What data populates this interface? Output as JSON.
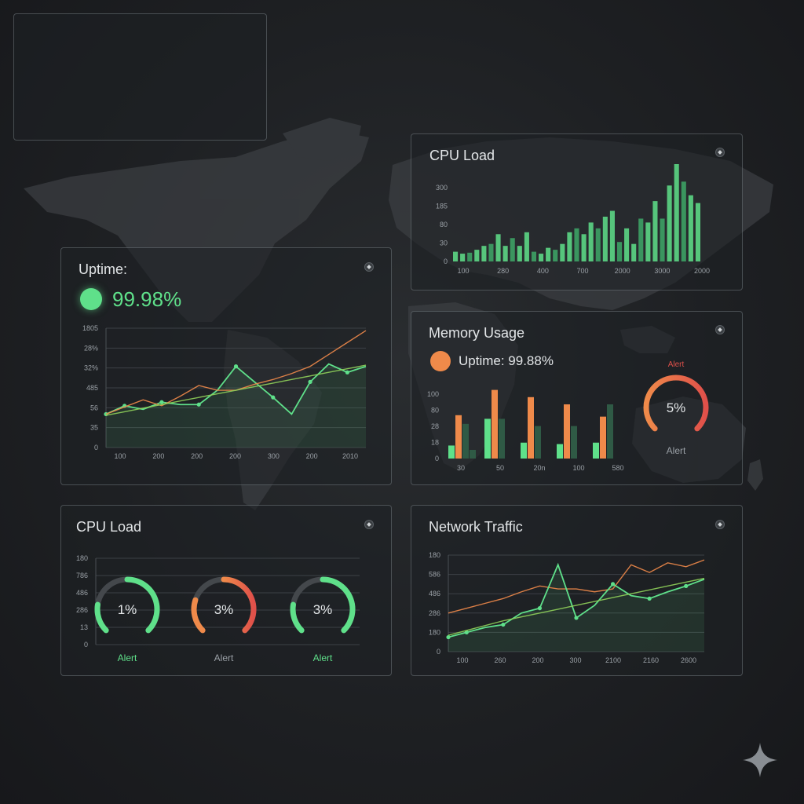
{
  "colors": {
    "green": "#5fe08a",
    "orange": "#ef8a4a",
    "red": "#e0504a",
    "dark_green": "#2f5a45",
    "panel_border": "#8a9096"
  },
  "icons": {
    "panel_menu": "settings-dot-icon",
    "brand": "sparkle-icon",
    "map": "world-map"
  },
  "uptime_panel": {
    "title": "Uptime:",
    "value": "99.98%"
  },
  "cpu_bar_panel": {
    "title": "CPU Load"
  },
  "memory_panel": {
    "title": "Memory Usage",
    "status_text": "Uptime: 99.88%",
    "gauge_value": "5%",
    "gauge_top_label": "Alert",
    "gauge_bottom_label": "Alert"
  },
  "cpu_gauge_panel": {
    "title": "CPU Load",
    "gauges": [
      {
        "value": "1%",
        "label": "Alert"
      },
      {
        "value": "3%",
        "label": "Alert"
      },
      {
        "value": "3%",
        "label": "Alert"
      }
    ]
  },
  "network_panel": {
    "title": "Network Traffic"
  },
  "chart_data": [
    {
      "id": "uptime",
      "type": "line",
      "y_ticks": [
        "1805",
        "28%",
        "32%",
        "485",
        "56",
        "35",
        "0"
      ],
      "x_ticks": [
        "100",
        "200",
        "200",
        "200",
        "300",
        "200",
        "2010"
      ],
      "ylim": [
        0,
        100
      ],
      "grid": true,
      "series": [
        {
          "color": "#5fe08a",
          "markers": true,
          "values": [
            28,
            35,
            32,
            38,
            36,
            36,
            48,
            68,
            55,
            42,
            28,
            55,
            70,
            63,
            68
          ]
        },
        {
          "color": "#ef8a4a",
          "markers": false,
          "values": [
            28,
            34,
            40,
            35,
            43,
            52,
            48,
            48,
            53,
            57,
            62,
            68,
            78,
            88,
            98
          ]
        },
        {
          "color": "#8fd05a",
          "markers": false,
          "values": [
            27,
            30,
            33,
            36,
            39,
            42,
            45,
            48,
            51,
            54,
            57,
            60,
            63,
            66,
            69
          ]
        }
      ]
    },
    {
      "id": "cpu_bars",
      "type": "bar",
      "y_ticks": [
        "300",
        "185",
        "80",
        "30",
        "0"
      ],
      "x_ticks": [
        "100",
        "280",
        "400",
        "700",
        "2000",
        "3000",
        "2000"
      ],
      "ylim": [
        0,
        100
      ],
      "values": [
        10,
        8,
        9,
        12,
        16,
        18,
        28,
        16,
        24,
        16,
        30,
        10,
        8,
        14,
        12,
        18,
        30,
        34,
        28,
        40,
        34,
        46,
        52,
        20,
        34,
        18,
        44,
        40,
        62,
        44,
        78,
        100,
        82,
        68,
        60
      ]
    },
    {
      "id": "memory_bars",
      "type": "bar",
      "y_ticks": [
        "100",
        "80",
        "28",
        "18",
        "0"
      ],
      "x_ticks": [
        "30",
        "50",
        "20n",
        "100",
        "580"
      ],
      "ylim": [
        0,
        100
      ],
      "groups": [
        [
          18,
          60,
          48,
          12
        ],
        [
          55,
          95,
          55,
          0
        ],
        [
          22,
          85,
          45,
          0
        ],
        [
          20,
          75,
          45,
          0
        ],
        [
          22,
          58,
          75,
          0
        ]
      ]
    },
    {
      "id": "cpu_gauges",
      "type": "other",
      "y_ticks": [
        "180",
        "786",
        "486",
        "286",
        "13",
        "0"
      ]
    },
    {
      "id": "network",
      "type": "area",
      "y_ticks": [
        "180",
        "586",
        "486",
        "286",
        "180",
        "0"
      ],
      "x_ticks": [
        "100",
        "260",
        "200",
        "300",
        "2100",
        "2160",
        "2600"
      ],
      "ylim": [
        0,
        100
      ],
      "grid": true,
      "series": [
        {
          "color": "#ef8a4a",
          "markers": false,
          "values": [
            40,
            45,
            50,
            55,
            62,
            68,
            65,
            65,
            62,
            65,
            90,
            82,
            92,
            88,
            95
          ]
        },
        {
          "color": "#5fe08a",
          "markers": true,
          "values": [
            15,
            20,
            25,
            28,
            40,
            45,
            90,
            35,
            48,
            70,
            58,
            55,
            62,
            68,
            75
          ]
        },
        {
          "color": "#8fd05a",
          "markers": false,
          "values": [
            17,
            22,
            27,
            32,
            36,
            40,
            44,
            48,
            52,
            56,
            60,
            64,
            68,
            72,
            76
          ]
        }
      ]
    }
  ]
}
